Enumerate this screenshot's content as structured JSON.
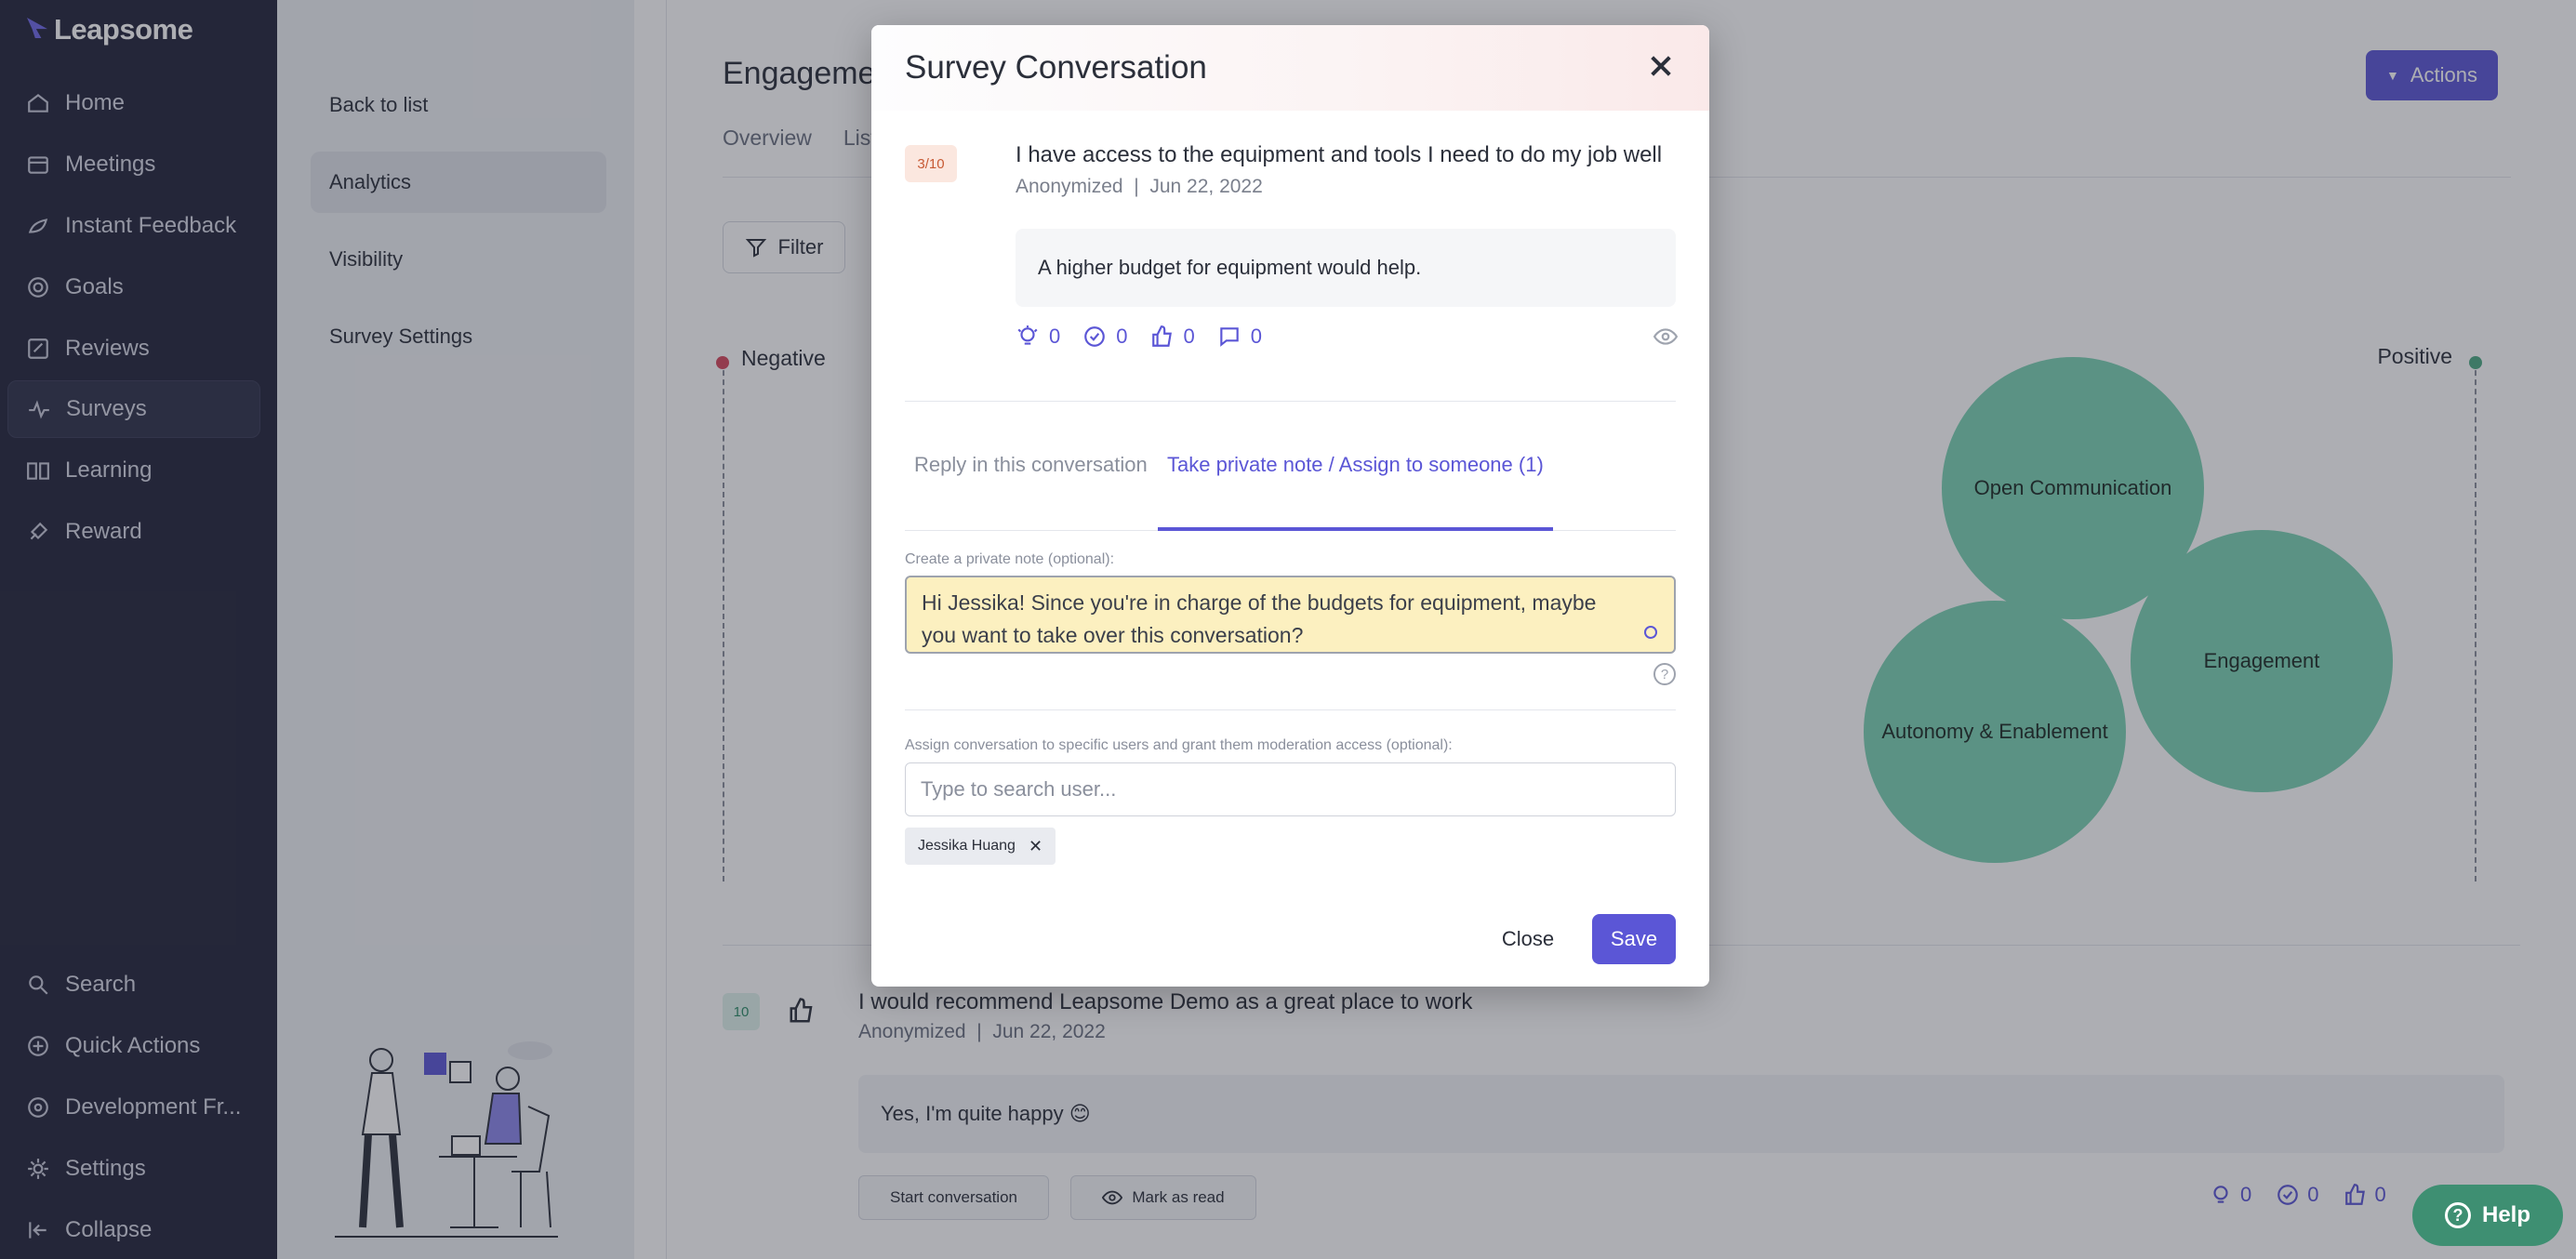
{
  "nav": {
    "brand": "Leapsome",
    "items": [
      {
        "label": "Home",
        "icon": "home-icon"
      },
      {
        "label": "Meetings",
        "icon": "meetings-icon"
      },
      {
        "label": "Instant Feedback",
        "icon": "feedback-icon"
      },
      {
        "label": "Goals",
        "icon": "goals-icon"
      },
      {
        "label": "Reviews",
        "icon": "reviews-icon"
      },
      {
        "label": "Surveys",
        "icon": "surveys-icon",
        "active": true
      },
      {
        "label": "Learning",
        "icon": "learning-icon"
      },
      {
        "label": "Reward",
        "icon": "reward-icon"
      }
    ],
    "bottom_items": [
      {
        "label": "Search",
        "icon": "search-icon"
      },
      {
        "label": "Quick Actions",
        "icon": "quick-actions-icon"
      },
      {
        "label": "Development Fr...",
        "icon": "development-icon"
      },
      {
        "label": "Settings",
        "icon": "settings-icon"
      },
      {
        "label": "Collapse",
        "icon": "collapse-icon"
      }
    ]
  },
  "subnav": {
    "items": [
      {
        "label": "Back to list"
      },
      {
        "label": "Analytics",
        "active": true
      },
      {
        "label": "Visibility"
      },
      {
        "label": "Survey Settings"
      }
    ]
  },
  "main": {
    "title": "Engagemen",
    "tabs": [
      "Overview",
      "List"
    ],
    "actions_label": "Actions",
    "filter_label": "Filter",
    "chart": {
      "negative_label": "Negative",
      "positive_label": "Positive",
      "bubbles": [
        "Open Communication",
        "Engagement",
        "Autonomy & Enablement"
      ]
    },
    "feed_item": {
      "score": "10",
      "question": "I would recommend Leapsome Demo as a great place to work",
      "meta": "Anonymized  |  Jun 22, 2022",
      "answer": "Yes, I'm quite happy 😊",
      "start_label": "Start conversation",
      "mark_label": "Mark as read",
      "counts": [
        "0",
        "0",
        "0"
      ]
    },
    "help_label": "Help"
  },
  "modal": {
    "title": "Survey Conversation",
    "score": "3/10",
    "question": "I have access to the equipment and tools I need to do my job well",
    "meta": "Anonymized  |  Jun 22, 2022",
    "answer": "A higher budget for equipment would help.",
    "counts": [
      "0",
      "0",
      "0",
      "0"
    ],
    "tabs": [
      "Reply in this conversation",
      "Take private note / Assign to someone (1)"
    ],
    "note_label": "Create a private note (optional):",
    "note_text": "Hi Jessika! Since you're in charge of the budgets for equipment, maybe you want to take over this conversation?",
    "assign_label": "Assign conversation to specific users and grant them moderation access (optional):",
    "assign_placeholder": "Type to search user...",
    "chip_label": "Jessika Huang",
    "close_label": "Close",
    "save_label": "Save"
  },
  "colors": {
    "nav_bg": "#23253a",
    "accent": "#5b56d6",
    "bubble": "#7bd2b3",
    "help": "#3e8f72",
    "negative": "#d6485c",
    "positive": "#4caa84"
  }
}
